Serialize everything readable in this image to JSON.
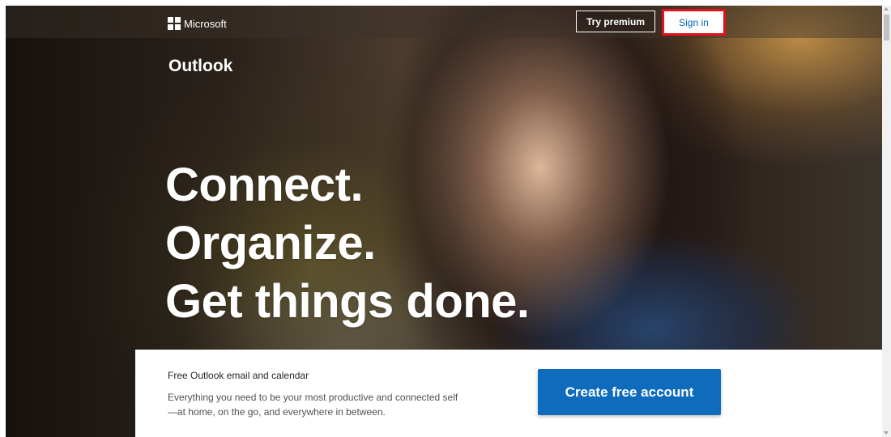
{
  "header": {
    "logo_text": "Microsoft",
    "try_premium_label": "Try premium",
    "sign_in_label": "Sign in"
  },
  "hero": {
    "brand": "Outlook",
    "headline": [
      "Connect.",
      "Organize.",
      "Get things done."
    ]
  },
  "promo": {
    "title": "Free Outlook email and calendar",
    "description": "Everything you need to be your most productive and connected self—at home, on the go, and everywhere in between.",
    "cta_label": "Create free account"
  },
  "colors": {
    "accent_blue": "#0f6cbd",
    "link_blue": "#0067b8",
    "highlight_red": "#e8101a"
  }
}
